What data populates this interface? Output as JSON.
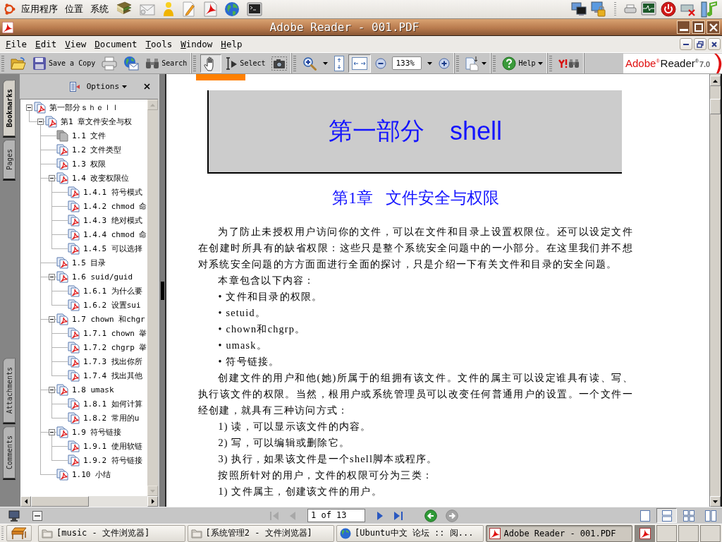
{
  "top_panel": {
    "menus": [
      "应用程序",
      "位置",
      "系统"
    ]
  },
  "window": {
    "title": "Adobe Reader - 001.PDF"
  },
  "menu_bar": [
    "File",
    "Edit",
    "View",
    "Document",
    "Tools",
    "Window",
    "Help"
  ],
  "toolbar": {
    "save_copy": "Save a Copy",
    "search": "Search",
    "tools": [
      {
        "kind": "hand",
        "selected": true
      },
      {
        "kind": "select",
        "label": "Select",
        "selected": false
      },
      {
        "kind": "snapshot",
        "selected": false
      }
    ],
    "fit": [
      {
        "kind": "page",
        "selected": false
      },
      {
        "kind": "width",
        "selected": true
      }
    ],
    "zoom": "133%",
    "help": "Help"
  },
  "logo": {
    "brand": "Adobe$^{®}$",
    "product": "Reader$^{®}$",
    "version": "7.0"
  },
  "bookmarks_panel": {
    "tabs": [
      {
        "label": "Bookmarks",
        "selected": true
      },
      {
        "label": "Pages",
        "selected": false
      }
    ],
    "lower_tabs": [
      {
        "label": "Attachments",
        "selected": false
      },
      {
        "label": "Comments",
        "selected": false
      }
    ],
    "options": "Options",
    "items": [
      {
        "label": "第一部分ｓｈｅｌｌ",
        "current": false,
        "expanded": true,
        "children": [
          {
            "label": "第1 章文件安全与权",
            "current": false,
            "expanded": true,
            "children": [
              {
                "label": "1.1 文件",
                "current": true
              },
              {
                "label": "1.2 文件类型",
                "current": false
              },
              {
                "label": "1.3 权限",
                "current": false
              },
              {
                "label": "1.4 改变权限位",
                "current": false,
                "expanded": true,
                "children": [
                  {
                    "label": "1.4.1 符号模式",
                    "current": false
                  },
                  {
                    "label": "1.4.2 chmod 命",
                    "current": false
                  },
                  {
                    "label": "1.4.3 绝对模式",
                    "current": false
                  },
                  {
                    "label": "1.4.4 chmod 命",
                    "current": false
                  },
                  {
                    "label": "1.4.5 可以选择",
                    "current": false
                  }
                ]
              },
              {
                "label": "1.5 目录",
                "current": false
              },
              {
                "label": "1.6 suid/guid",
                "current": false,
                "expanded": true,
                "children": [
                  {
                    "label": "1.6.1 为什么要",
                    "current": false
                  },
                  {
                    "label": "1.6.2 设置sui",
                    "current": false
                  }
                ]
              },
              {
                "label": "1.7 chown 和chgr",
                "current": false,
                "expanded": true,
                "children": [
                  {
                    "label": "1.7.1 chown 举",
                    "current": false
                  },
                  {
                    "label": "1.7.2 chgrp 举",
                    "current": false
                  },
                  {
                    "label": "1.7.3 找出你所",
                    "current": false
                  },
                  {
                    "label": "1.7.4 找出其他",
                    "current": false
                  }
                ]
              },
              {
                "label": "1.8 umask",
                "current": false,
                "expanded": true,
                "children": [
                  {
                    "label": "1.8.1 如何计算",
                    "current": false
                  },
                  {
                    "label": "1.8.2 常用的u",
                    "current": false
                  }
                ]
              },
              {
                "label": "1.9 符号链接",
                "current": false,
                "expanded": true,
                "children": [
                  {
                    "label": "1.9.1 使用软链",
                    "current": false
                  },
                  {
                    "label": "1.9.2 符号链接",
                    "current": false
                  }
                ]
              },
              {
                "label": "1.10 小结",
                "current": false
              }
            ]
          }
        ]
      }
    ]
  },
  "document": {
    "part_label": "第一部分",
    "part_name": "shell",
    "chapter_number": "第1章",
    "chapter_title": "文件安全与权限",
    "paragraphs": [
      "为了防止未授权用户访问你的文件，可以在文件和目录上设置权限位。还可以设定文件在创建时所具有的缺省权限：这些只是整个系统安全问题中的一小部分。在这里我们并不想对系统安全问题的方方面面进行全面的探讨，只是介绍一下有关文件和目录的安全问题。",
      "本章包含以下内容：",
      "• 文件和目录的权限。",
      "• setuid。",
      "• chown和chgrp。",
      "• umask。",
      "• 符号链接。",
      "创建文件的用户和他(她)所属于的组拥有该文件。文件的属主可以设定谁具有读、写、执行该文件的权限。当然，根用户或系统管理员可以改变任何普通用户的设置。一个文件一经创建，就具有三种访问方式：",
      "1) 读，可以显示该文件的内容。",
      "2) 写，可以编辑或删除它。",
      "3) 执行，如果该文件是一个shell脚本或程序。",
      "按照所针对的用户，文件的权限可分为三类：",
      "1) 文件属主，创建该文件的用户。"
    ]
  },
  "status_bar": {
    "nav": [
      {
        "kind": "first",
        "disabled": true
      },
      {
        "kind": "previous",
        "disabled": true
      },
      {
        "kind": "next",
        "disabled": false
      },
      {
        "kind": "last",
        "disabled": false
      }
    ],
    "page": "1 of 13",
    "history": [
      {
        "kind": "back",
        "disabled": false
      },
      {
        "kind": "forward",
        "disabled": true
      }
    ],
    "layouts": [
      {
        "kind": "single",
        "selected": false
      },
      {
        "kind": "continuous",
        "selected": true
      },
      {
        "kind": "facing",
        "selected": false
      },
      {
        "kind": "continuous_facing",
        "selected": false
      }
    ]
  },
  "taskbar": {
    "tasks": [
      {
        "label": "[music - 文件浏览器]",
        "kind": "folder",
        "selected": false
      },
      {
        "label": "[系统管理2 - 文件浏览器]",
        "kind": "folder",
        "selected": false
      },
      {
        "label": "[Ubuntu中文 论坛 :: 阅...",
        "kind": "browser",
        "selected": false
      },
      {
        "label": "Adobe Reader - 001.PDF",
        "kind": "reader",
        "selected": true
      }
    ],
    "workspaces": [
      {
        "selected": true
      },
      {
        "selected": false
      },
      {
        "selected": false
      },
      {
        "selected": false
      }
    ]
  }
}
